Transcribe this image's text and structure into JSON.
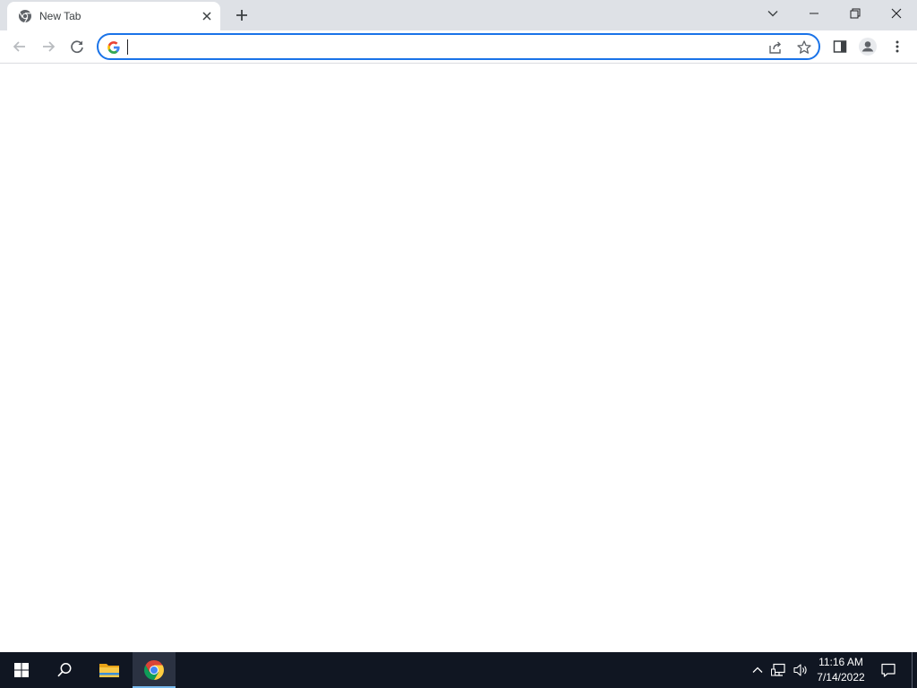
{
  "browser": {
    "tab": {
      "title": "New Tab",
      "favicon": "chrome-icon",
      "close_icon": "close-icon"
    },
    "new_tab_icon": "plus-icon",
    "tab_search_icon": "chevron-down-icon",
    "window_controls": {
      "minimize": "minimize-icon",
      "restore": "restore-icon",
      "close": "close-icon"
    }
  },
  "toolbar": {
    "back_icon": "arrow-left-icon",
    "forward_icon": "arrow-right-icon",
    "reload_icon": "reload-icon",
    "omnibox": {
      "value": "",
      "placeholder": "",
      "search_engine_icon": "google-g-icon",
      "share_icon": "share-icon",
      "bookmark_icon": "star-icon"
    },
    "side_panel_icon": "side-panel-icon",
    "profile_icon": "profile-icon",
    "menu_icon": "kebab-menu-icon"
  },
  "taskbar": {
    "start_icon": "windows-start-icon",
    "search_icon": "search-icon",
    "apps": [
      {
        "name": "File Explorer",
        "icon": "folder-icon",
        "active": false
      },
      {
        "name": "Google Chrome",
        "icon": "chrome-icon",
        "active": true
      }
    ],
    "tray": {
      "overflow_icon": "chevron-up-icon",
      "network_icon": "network-icon",
      "volume_icon": "volume-icon",
      "notifications_icon": "notification-icon"
    },
    "clock": {
      "time": "11:16 AM",
      "date": "7/14/2022"
    }
  },
  "colors": {
    "tabstrip_bg": "#dee1e6",
    "omnibox_focus": "#1a73e8",
    "taskbar_bg": "#101622",
    "taskbar_active_underline": "#76b9ed"
  }
}
